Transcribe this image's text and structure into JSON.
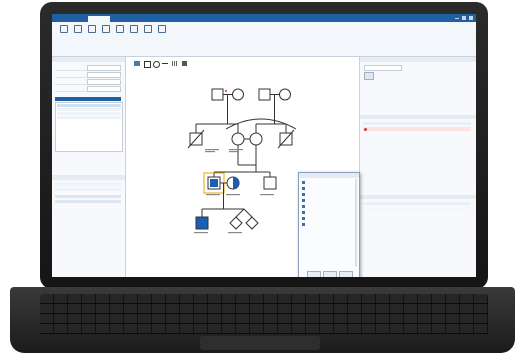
{
  "app": {
    "title": "",
    "accent": "#1f5fa3",
    "affected_fill": "#1a5fb4"
  },
  "ribbon": {
    "tools": [
      {
        "icon": "new-icon"
      },
      {
        "icon": "open-icon"
      },
      {
        "icon": "save-icon"
      },
      {
        "icon": "print-icon"
      },
      {
        "icon": "undo-icon"
      },
      {
        "icon": "redo-icon"
      },
      {
        "icon": "zoom-icon"
      },
      {
        "icon": "settings-icon"
      }
    ]
  },
  "left_panel": {
    "fields": [
      {
        "key": "",
        "value": ""
      },
      {
        "key": "",
        "value": ""
      },
      {
        "key": "",
        "value": ""
      },
      {
        "key": "",
        "value": ""
      }
    ]
  },
  "canvas": {
    "toolbar_icons": [
      "pointer-icon",
      "male-icon",
      "female-icon",
      "line-icon",
      "grid-icon",
      "delete-icon"
    ]
  },
  "context_menu": {
    "items": [
      "",
      "",
      "",
      "",
      "",
      "",
      "",
      ""
    ]
  },
  "right_panel": {
    "sections": [
      "",
      "",
      ""
    ]
  }
}
